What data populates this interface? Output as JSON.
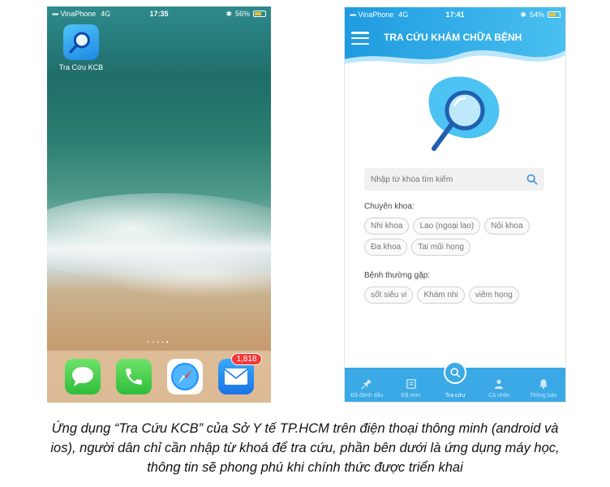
{
  "left_phone": {
    "status": {
      "signal": "▪▪▪▪",
      "carrier": "VinaPhone",
      "network": "4G",
      "time": "17:35",
      "battery": "56%",
      "battery_level": 0.56
    },
    "home_app": {
      "label": "Tra Cứu KCB",
      "icon": "magnifier-icon"
    },
    "page_dots": "••••",
    "page_dot_active": "•",
    "dock": [
      {
        "name": "Messages",
        "icon": "message-bubble-icon"
      },
      {
        "name": "Phone",
        "icon": "phone-icon"
      },
      {
        "name": "Safari",
        "icon": "compass-icon"
      },
      {
        "name": "Mail",
        "icon": "envelope-icon",
        "badge": "1,818"
      }
    ]
  },
  "right_phone": {
    "status": {
      "signal": "▪▪▪▪",
      "carrier": "VinaPhone",
      "network": "4G",
      "time": "17:41",
      "battery": "54%",
      "battery_level": 0.54
    },
    "header": {
      "title": "TRA CỨU KHÁM CHỮA BỆNH",
      "menu_icon": "hamburger-icon"
    },
    "search": {
      "placeholder": "Nhập từ khóa tìm kiếm",
      "icon": "search-icon"
    },
    "specialties": {
      "label": "Chuyên khoa:",
      "chips": [
        "Nhi khoa",
        "Lao (ngoại lao)",
        "Nội khoa",
        "Đa khoa",
        "Tai mũi họng"
      ]
    },
    "common_diseases": {
      "label": "Bệnh thường gặp:",
      "chips": [
        "sốt siêu vi",
        "Khám nhi",
        "viêm họng"
      ]
    },
    "tabbar": [
      {
        "label": "Đã đánh dấu",
        "icon": "pin-icon"
      },
      {
        "label": "Đã xem",
        "icon": "history-icon"
      },
      {
        "label": "Tra cứu",
        "icon": "search-icon",
        "active": true
      },
      {
        "label": "Cá nhân",
        "icon": "person-icon"
      },
      {
        "label": "Thông báo",
        "icon": "bell-icon"
      }
    ],
    "colors": {
      "primary": "#3aa9e6",
      "header_gradient_start": "#1e9be0",
      "header_gradient_end": "#49c0f0"
    }
  },
  "caption": {
    "line1": "Ứng dụng “Tra Cứu KCB” của Sở Y tế TP.HCM trên điện thoại thông minh (android và",
    "line2": "ios), người dân chỉ cần nhập từ khoá để tra cứu, phần bên dưới là ứng dụng máy học,",
    "line3": "thông tin sẽ phong phú khi chính thức được triển khai"
  }
}
